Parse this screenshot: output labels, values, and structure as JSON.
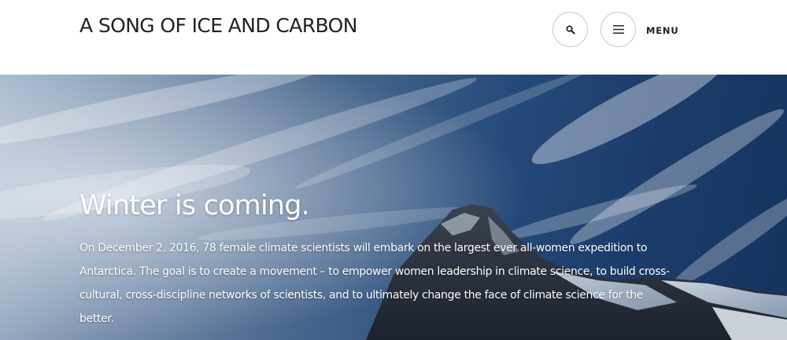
{
  "header": {
    "site_title": "A SONG OF ICE AND CARBON",
    "search_icon": "search-icon",
    "menu_icon": "hamburger-menu-icon",
    "menu_label": "MENU"
  },
  "hero": {
    "title": "Winter is coming.",
    "text": "On December 2, 2016, 78 female climate scientists will embark on the largest ever all-women expedition to Antarctica. The goal is to create a movement – to empower women leadership in climate science, to build cross-cultural, cross-discipline networks of scientists, and to ultimately change the face of climate science for the better."
  },
  "colors": {
    "header_background": "#ffffff",
    "title_text": "#222222",
    "button_border": "#c9c9c9",
    "hero_sky_light": "#a3b6cb",
    "hero_sky_dark": "#15335f",
    "hero_text": "#ffffff"
  }
}
